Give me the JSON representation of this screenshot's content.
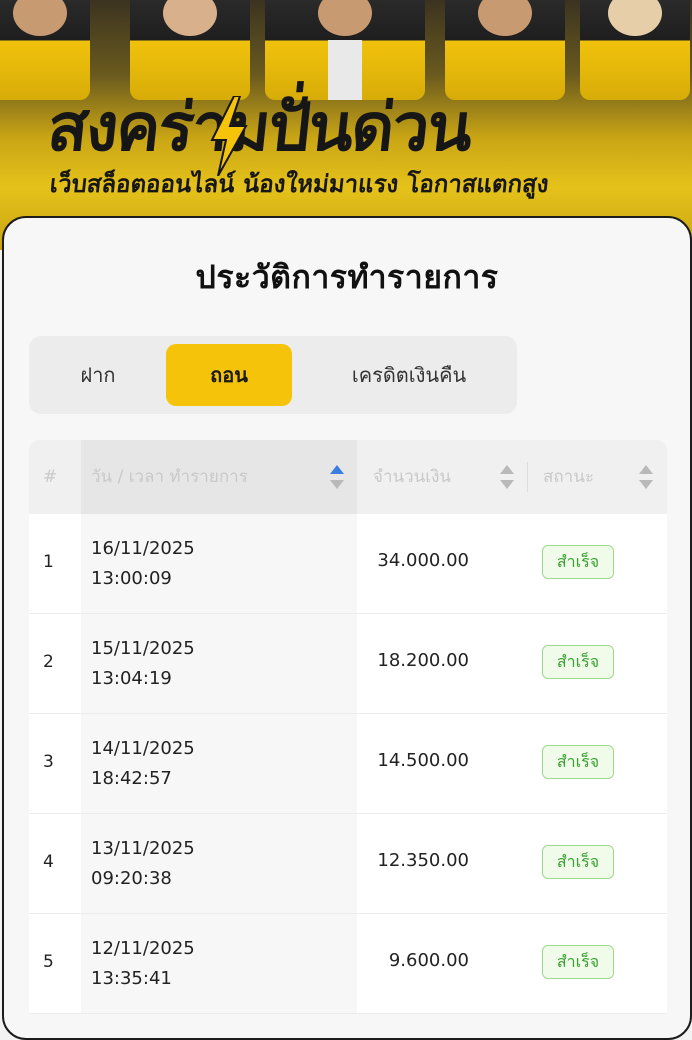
{
  "banner": {
    "title": "สงคร่ามปั่นด่วน",
    "subtitle": "เว็บสล็อตออนไลน์ น้องใหม่มาแรง โอกาสแตกสูง"
  },
  "modal": {
    "title": "ประวัติการทำรายการ",
    "tabs": [
      {
        "label": "ฝาก",
        "active": false
      },
      {
        "label": "ถอน",
        "active": true
      },
      {
        "label": "เครดิตเงินคืน",
        "active": false
      }
    ]
  },
  "table": {
    "headers": {
      "index": "#",
      "datetime": "วัน / เวลา ทำรายการ",
      "amount": "จำนวนเงิน",
      "status": "สถานะ"
    },
    "rows": [
      {
        "index": "1",
        "date": "16/11/2025",
        "time": "13:00:09",
        "amount": "34.000.00",
        "status": "สำเร็จ"
      },
      {
        "index": "2",
        "date": "15/11/2025",
        "time": "13:04:19",
        "amount": "18.200.00",
        "status": "สำเร็จ"
      },
      {
        "index": "3",
        "date": "14/11/2025",
        "time": "18:42:57",
        "amount": "14.500.00",
        "status": "สำเร็จ"
      },
      {
        "index": "4",
        "date": "13/11/2025",
        "time": "09:20:38",
        "amount": "12.350.00",
        "status": "สำเร็จ"
      },
      {
        "index": "5",
        "date": "12/11/2025",
        "time": "13:35:41",
        "amount": "9.600.00",
        "status": "สำเร็จ"
      }
    ]
  },
  "colors": {
    "accent": "#f5c40a",
    "success_text": "#3aa12f",
    "success_border": "#9fd88c",
    "sort_active": "#3b7de0"
  }
}
